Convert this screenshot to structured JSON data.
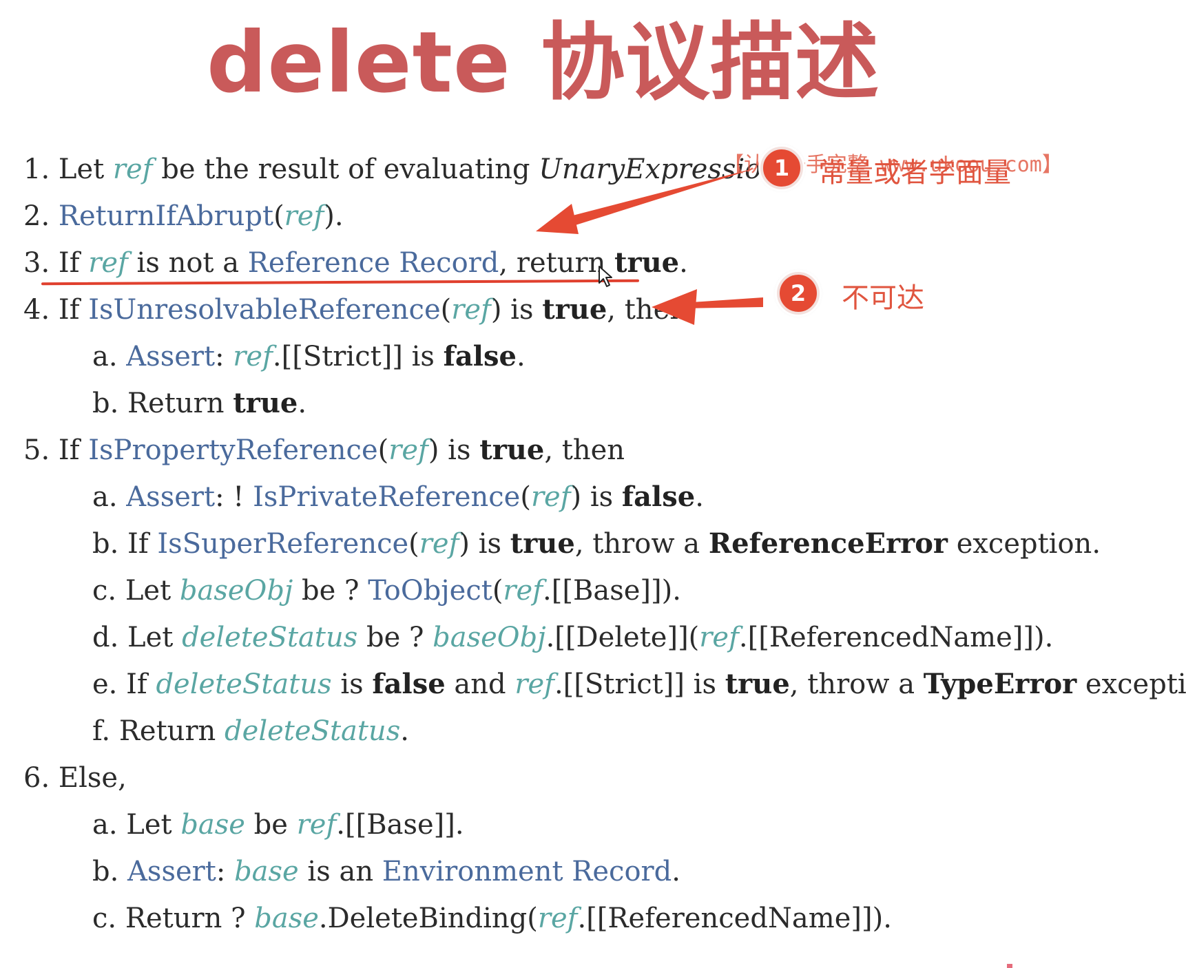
{
  "title": "delete 协议描述",
  "steps": [
    {
      "id": "s1",
      "level": 0,
      "parts": [
        {
          "t": "1. ",
          "c": "num"
        },
        {
          "t": "Let "
        },
        {
          "t": "ref",
          "c": "var"
        },
        {
          "t": " be the result of evaluating "
        },
        {
          "t": "UnaryExpression",
          "c": "var",
          "style": "color:#2b2b2b"
        },
        {
          "t": "."
        }
      ]
    },
    {
      "id": "s2",
      "level": 0,
      "parts": [
        {
          "t": "2. ",
          "c": "num"
        },
        {
          "t": "ReturnIfAbrupt",
          "c": "link"
        },
        {
          "t": "("
        },
        {
          "t": "ref",
          "c": "var"
        },
        {
          "t": ")."
        }
      ]
    },
    {
      "id": "s3",
      "level": 0,
      "parts": [
        {
          "t": "3. ",
          "c": "num"
        },
        {
          "t": "If "
        },
        {
          "t": "ref",
          "c": "var"
        },
        {
          "t": " is not a "
        },
        {
          "t": "Reference Record",
          "c": "link"
        },
        {
          "t": ", return "
        },
        {
          "t": "true",
          "c": "kw"
        },
        {
          "t": "."
        }
      ]
    },
    {
      "id": "s4",
      "level": 0,
      "parts": [
        {
          "t": "4. ",
          "c": "num"
        },
        {
          "t": "If "
        },
        {
          "t": "IsUnresolvableReference",
          "c": "link"
        },
        {
          "t": "("
        },
        {
          "t": "ref",
          "c": "var"
        },
        {
          "t": ") is "
        },
        {
          "t": "true",
          "c": "kw"
        },
        {
          "t": ", then"
        }
      ]
    },
    {
      "id": "s4a",
      "level": 1,
      "parts": [
        {
          "t": "a. ",
          "c": "num"
        },
        {
          "t": "Assert",
          "c": "link"
        },
        {
          "t": ": "
        },
        {
          "t": "ref",
          "c": "var"
        },
        {
          "t": ".[[Strict]] is "
        },
        {
          "t": "false",
          "c": "kw"
        },
        {
          "t": "."
        }
      ]
    },
    {
      "id": "s4b",
      "level": 1,
      "parts": [
        {
          "t": "b. ",
          "c": "num"
        },
        {
          "t": "Return "
        },
        {
          "t": "true",
          "c": "kw"
        },
        {
          "t": "."
        }
      ]
    },
    {
      "id": "s5",
      "level": 0,
      "parts": [
        {
          "t": "5. ",
          "c": "num"
        },
        {
          "t": "If "
        },
        {
          "t": "IsPropertyReference",
          "c": "link"
        },
        {
          "t": "("
        },
        {
          "t": "ref",
          "c": "var"
        },
        {
          "t": ") is "
        },
        {
          "t": "true",
          "c": "kw"
        },
        {
          "t": ", then"
        }
      ]
    },
    {
      "id": "s5a",
      "level": 1,
      "parts": [
        {
          "t": "a. ",
          "c": "num"
        },
        {
          "t": "Assert",
          "c": "link"
        },
        {
          "t": ": ! "
        },
        {
          "t": "IsPrivateReference",
          "c": "link"
        },
        {
          "t": "("
        },
        {
          "t": "ref",
          "c": "var"
        },
        {
          "t": ") is "
        },
        {
          "t": "false",
          "c": "kw"
        },
        {
          "t": "."
        }
      ]
    },
    {
      "id": "s5b",
      "level": 1,
      "parts": [
        {
          "t": "b. ",
          "c": "num"
        },
        {
          "t": "If "
        },
        {
          "t": "IsSuperReference",
          "c": "link"
        },
        {
          "t": "("
        },
        {
          "t": "ref",
          "c": "var"
        },
        {
          "t": ") is "
        },
        {
          "t": "true",
          "c": "kw"
        },
        {
          "t": ", throw a "
        },
        {
          "t": "ReferenceError",
          "c": "kw"
        },
        {
          "t": " exception."
        }
      ]
    },
    {
      "id": "s5c",
      "level": 1,
      "parts": [
        {
          "t": "c. ",
          "c": "num"
        },
        {
          "t": "Let "
        },
        {
          "t": "baseObj",
          "c": "var"
        },
        {
          "t": " be ? "
        },
        {
          "t": "ToObject",
          "c": "link"
        },
        {
          "t": "("
        },
        {
          "t": "ref",
          "c": "var"
        },
        {
          "t": ".[[Base]])."
        }
      ]
    },
    {
      "id": "s5d",
      "level": 1,
      "parts": [
        {
          "t": "d. ",
          "c": "num"
        },
        {
          "t": "Let "
        },
        {
          "t": "deleteStatus",
          "c": "var"
        },
        {
          "t": " be ? "
        },
        {
          "t": "baseObj",
          "c": "var"
        },
        {
          "t": ".[[Delete]]("
        },
        {
          "t": "ref",
          "c": "var"
        },
        {
          "t": ".[[ReferencedName]])."
        }
      ]
    },
    {
      "id": "s5e",
      "level": 1,
      "parts": [
        {
          "t": "e. ",
          "c": "num"
        },
        {
          "t": "If "
        },
        {
          "t": "deleteStatus",
          "c": "var"
        },
        {
          "t": " is "
        },
        {
          "t": "false",
          "c": "kw"
        },
        {
          "t": " and "
        },
        {
          "t": "ref",
          "c": "var"
        },
        {
          "t": ".[[Strict]] is "
        },
        {
          "t": "true",
          "c": "kw"
        },
        {
          "t": ", throw a "
        },
        {
          "t": "TypeError",
          "c": "kw"
        },
        {
          "t": " exception."
        }
      ]
    },
    {
      "id": "s5f",
      "level": 1,
      "parts": [
        {
          "t": "f. ",
          "c": "num"
        },
        {
          "t": "Return "
        },
        {
          "t": "deleteStatus",
          "c": "var"
        },
        {
          "t": "."
        }
      ]
    },
    {
      "id": "s6",
      "level": 0,
      "parts": [
        {
          "t": "6. ",
          "c": "num"
        },
        {
          "t": "Else,"
        }
      ]
    },
    {
      "id": "s6a",
      "level": 1,
      "parts": [
        {
          "t": "a. ",
          "c": "num"
        },
        {
          "t": "Let "
        },
        {
          "t": "base",
          "c": "var"
        },
        {
          "t": " be "
        },
        {
          "t": "ref",
          "c": "var"
        },
        {
          "t": ".[[Base]]."
        }
      ]
    },
    {
      "id": "s6b",
      "level": 1,
      "parts": [
        {
          "t": "b. ",
          "c": "num"
        },
        {
          "t": "Assert",
          "c": "link"
        },
        {
          "t": ": "
        },
        {
          "t": "base",
          "c": "var"
        },
        {
          "t": " is an "
        },
        {
          "t": "Environment Record",
          "c": "link"
        },
        {
          "t": "."
        }
      ]
    },
    {
      "id": "s6c",
      "level": 1,
      "parts": [
        {
          "t": "c. ",
          "c": "num"
        },
        {
          "t": "Return ? "
        },
        {
          "t": "base",
          "c": "var"
        },
        {
          "t": ".DeleteBinding("
        },
        {
          "t": "ref",
          "c": "var"
        },
        {
          "t": ".[[ReferencedName]])."
        }
      ]
    }
  ],
  "annotations": {
    "badge1": "1",
    "note1": "常量或者字面量",
    "watermark": "【认准一手完整 www.ukoou.com】",
    "badge2": "2",
    "note2": "不可达"
  },
  "colors": {
    "title": "#c95a5a",
    "variable": "#5aa6a3",
    "link": "#4a6a9c",
    "annotation": "#e54a33"
  }
}
